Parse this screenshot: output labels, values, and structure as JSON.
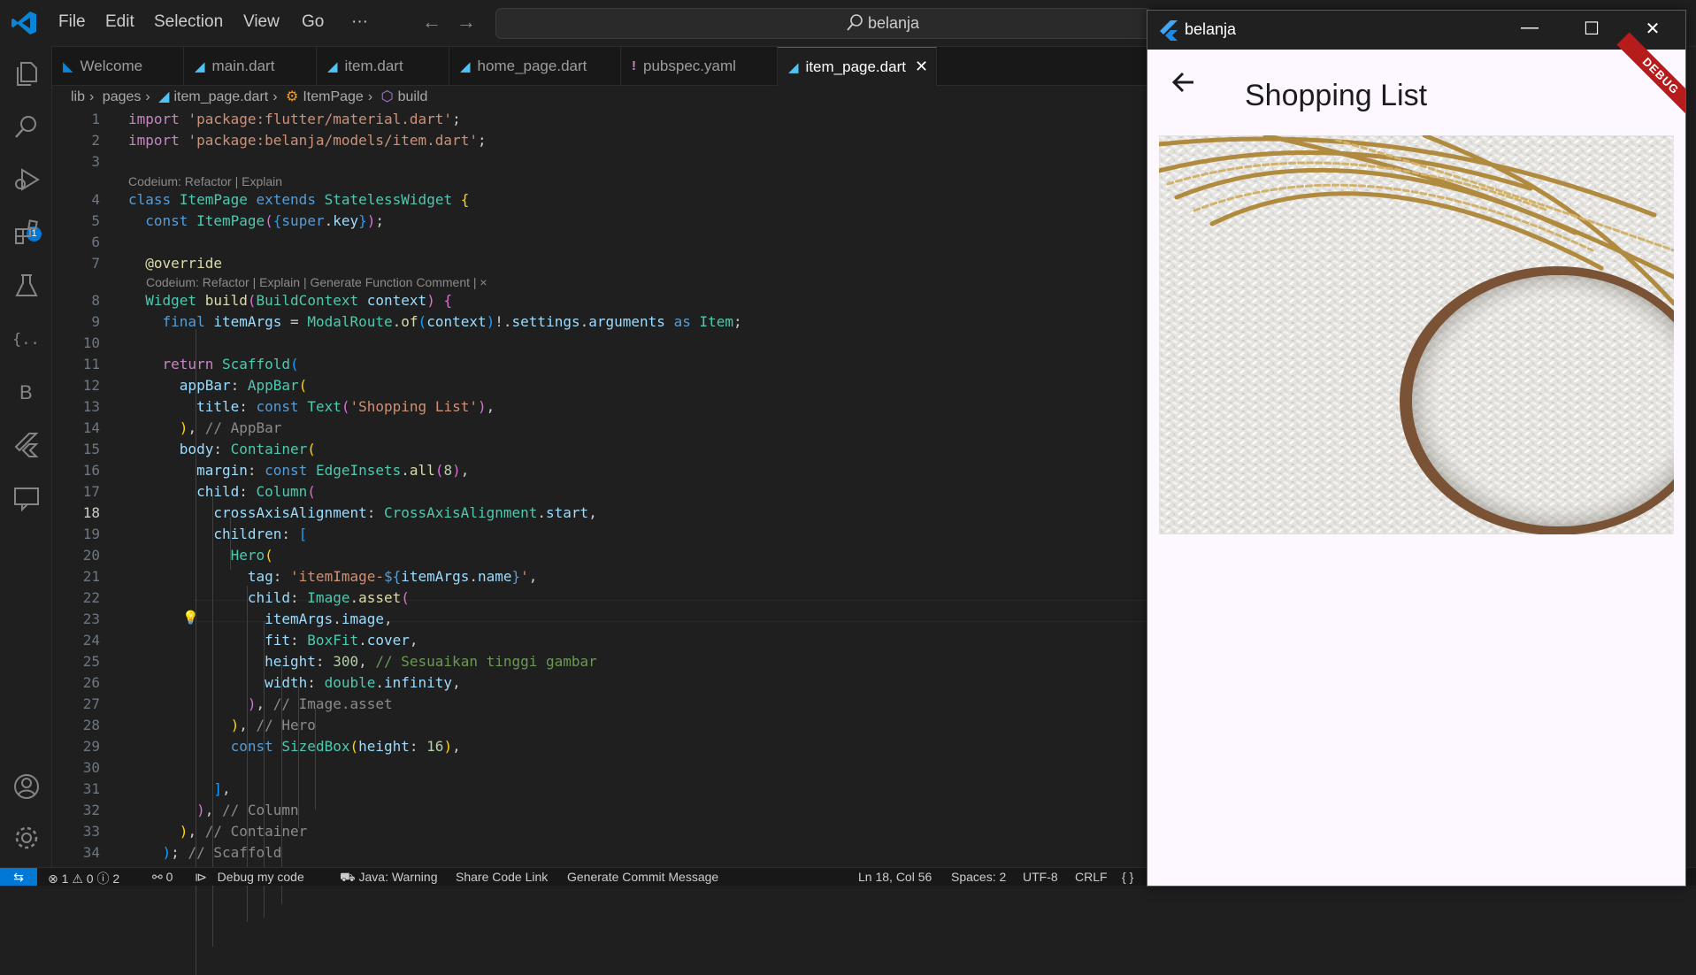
{
  "menu": [
    "File",
    "Edit",
    "Selection",
    "View",
    "Go",
    "···"
  ],
  "search": {
    "label": "belanja"
  },
  "activity_badge": "1",
  "activity_letter": "B",
  "tabs": [
    {
      "label": "Welcome",
      "icon": "vscode-icon"
    },
    {
      "label": "main.dart",
      "icon": "dart-icon"
    },
    {
      "label": "item.dart",
      "icon": "dart-icon"
    },
    {
      "label": "home_page.dart",
      "icon": "dart-icon"
    },
    {
      "label": "pubspec.yaml",
      "icon": "yaml-icon",
      "glyph": "!"
    },
    {
      "label": "item_page.dart",
      "icon": "dart-icon",
      "active": true
    }
  ],
  "breadcrumb": [
    "lib",
    "pages",
    "item_page.dart",
    "ItemPage",
    "build"
  ],
  "codelens": {
    "class": "Codeium: Refactor | Explain",
    "build": "Codeium: Refactor | Explain | Generate Function Comment | ×"
  },
  "line_numbers": [
    "1",
    "2",
    "3",
    "4",
    "5",
    "6",
    "7",
    "8",
    "9",
    "10",
    "11",
    "12",
    "13",
    "14",
    "15",
    "16",
    "17",
    "18",
    "19",
    "20",
    "21",
    "22",
    "23",
    "24",
    "25",
    "26",
    "27",
    "28",
    "29",
    "30",
    "31",
    "32",
    "33",
    "34"
  ],
  "status": {
    "errors": "1",
    "warnings": "0",
    "info": "2",
    "ports": "0",
    "debug": "Debug my code",
    "java": "Java: Warning",
    "share": "Share Code Link",
    "commit": "Generate Commit Message",
    "cursor": "Ln 18, Col 56",
    "spaces": "Spaces: 2",
    "encoding": "UTF-8",
    "eol": "CRLF",
    "lang": "{ }"
  },
  "app": {
    "window_title": "belanja",
    "appbar_title": "Shopping List",
    "debug_label": "DEBUG"
  },
  "colors": {
    "accent": "#0078d4",
    "editor_bg": "#1f1f1f",
    "app_bg": "#fdf7ff",
    "debug_banner": "#b71c1c"
  }
}
